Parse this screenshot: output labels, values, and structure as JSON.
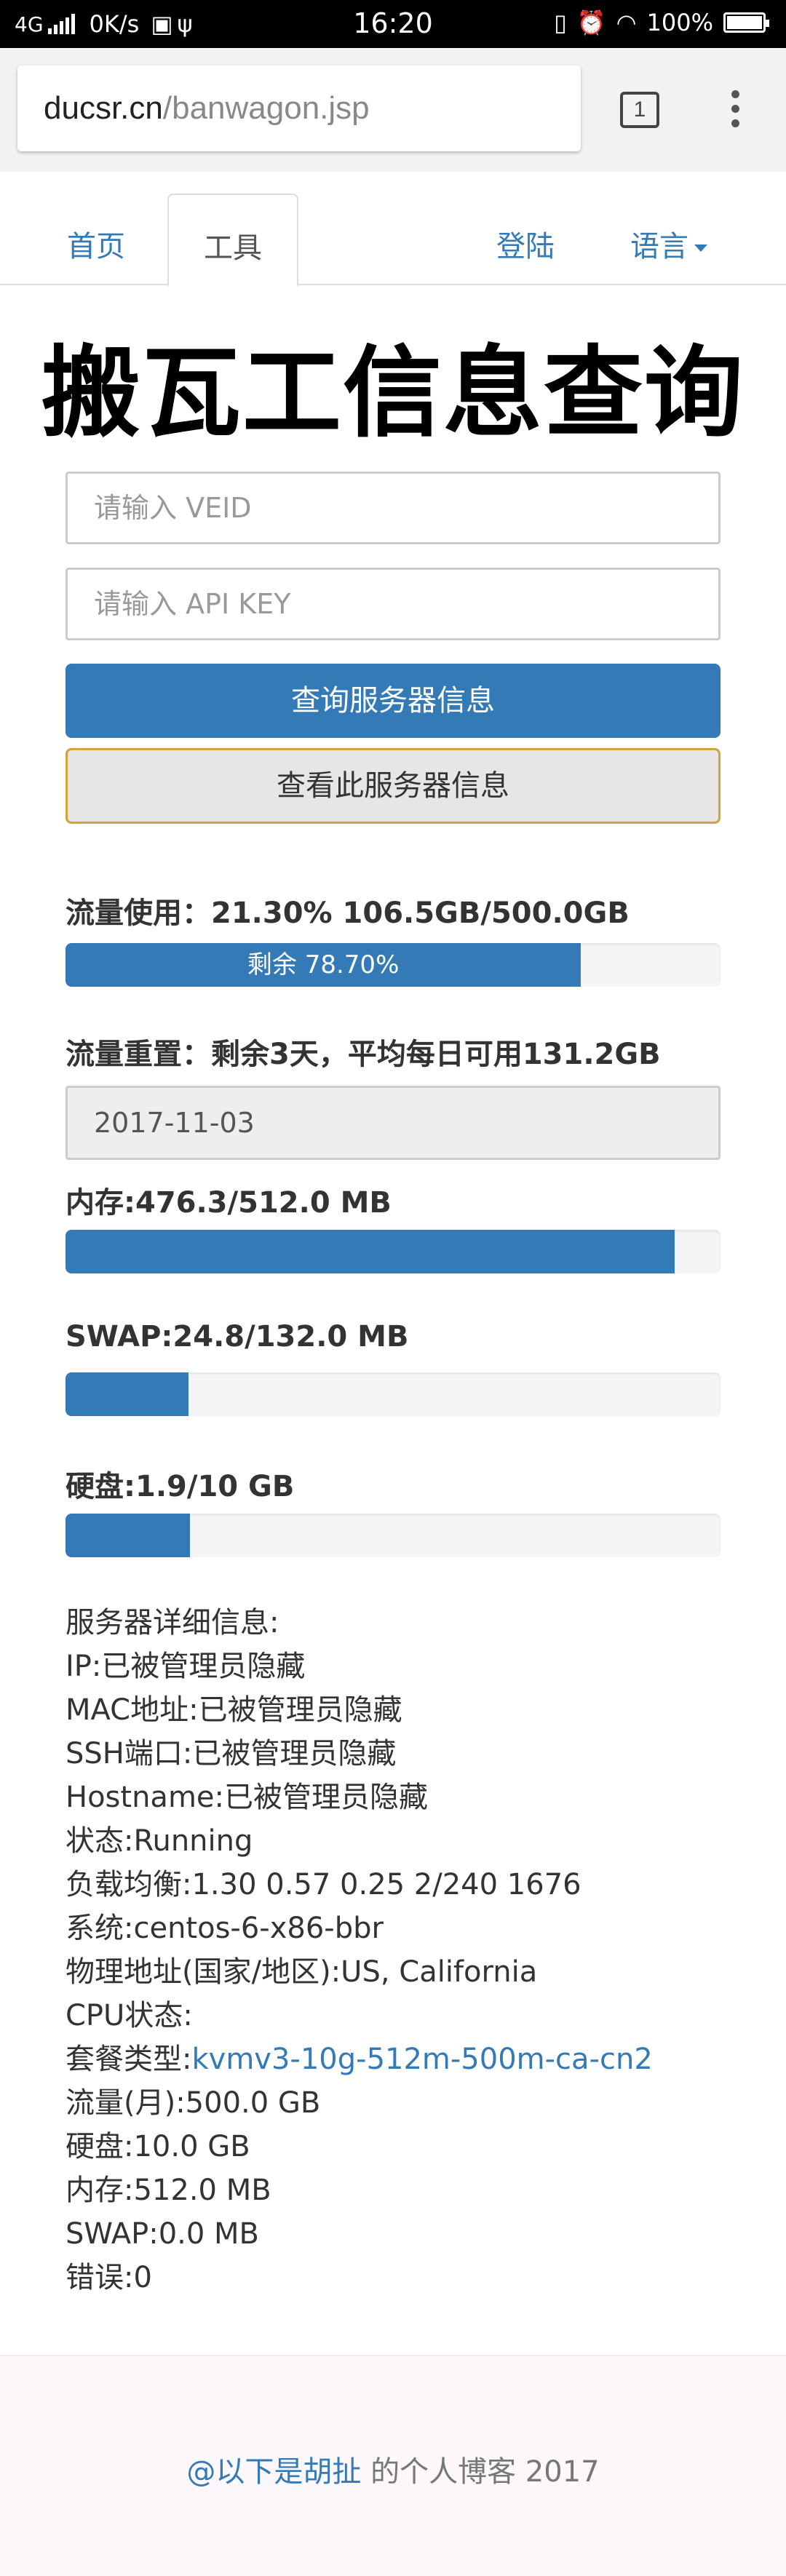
{
  "status_bar": {
    "network": "4G",
    "speed": "0K/s",
    "time": "16:20",
    "battery": "100%"
  },
  "browser": {
    "url_domain": "ducsr.cn",
    "url_path": "/banwagon.jsp",
    "tab_count": "1"
  },
  "nav": {
    "home": "首页",
    "tools": "工具",
    "login": "登陆",
    "language": "语言"
  },
  "title": "搬瓦工信息查询",
  "form": {
    "veid_placeholder": "请输入 VEID",
    "apikey_placeholder": "请输入 API KEY",
    "query_button": "查询服务器信息",
    "view_button": "查看此服务器信息"
  },
  "usage": {
    "traffic_label": "流量使用：21.30% 106.5GB/500.0GB",
    "traffic_used_fraction": 0.787,
    "traffic_remaining": "剩余 78.70%",
    "reset_label": "流量重置：剩余3天，平均每日可用131.2GB",
    "reset_date": "2017-11-03",
    "memory_label": "内存:476.3/512.0 MB",
    "memory_fraction": 0.93,
    "swap_label": "SWAP:24.8/132.0 MB",
    "swap_fraction": 0.188,
    "disk_label": "硬盘:1.9/10 GB",
    "disk_fraction": 0.19
  },
  "details": {
    "heading": "服务器详细信息:",
    "ip": "IP:已被管理员隐藏",
    "mac": "MAC地址:已被管理员隐藏",
    "ssh": "SSH端口:已被管理员隐藏",
    "hostname": "Hostname:已被管理员隐藏",
    "status": "状态:Running",
    "load": "负载均衡:1.30 0.57 0.25 2/240 1676",
    "os": "系统:centos-6-x86-bbr",
    "location": "物理地址(国家/地区):US, California",
    "cpu": "CPU状态:",
    "plan_prefix": "套餐类型:",
    "plan_value": "kvmv3-10g-512m-500m-ca-cn2",
    "traffic_month": "流量(月):500.0 GB",
    "disk": "硬盘:10.0 GB",
    "memory": "内存:512.0 MB",
    "swap": "SWAP:0.0 MB",
    "error": "错误:0"
  },
  "footer": {
    "author_link": "@以下是胡扯",
    "suffix": " 的个人博客 2017"
  }
}
